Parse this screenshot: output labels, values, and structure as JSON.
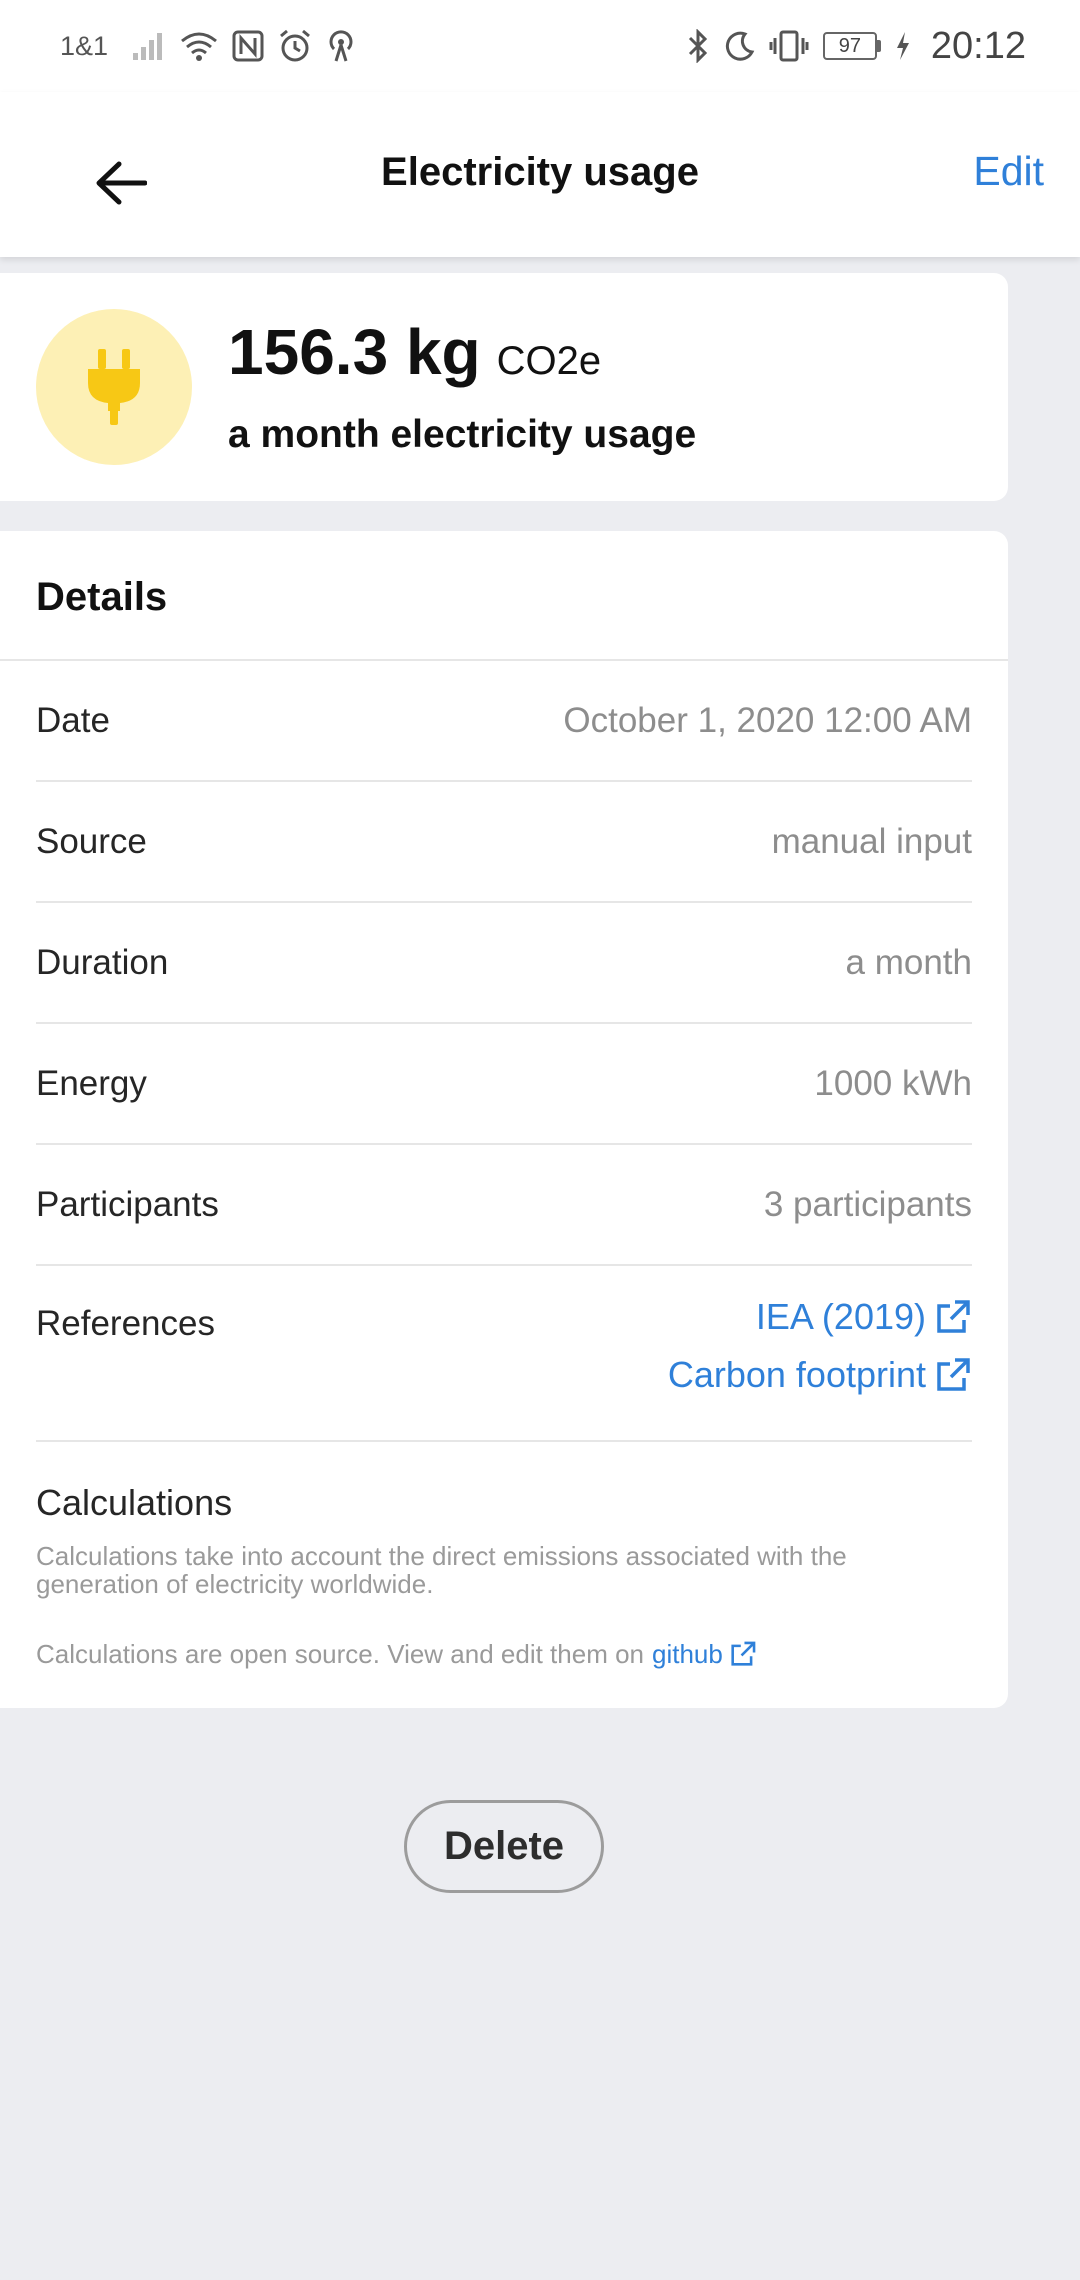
{
  "status_bar": {
    "carrier": "1&1",
    "battery": "97",
    "time": "20:12"
  },
  "appbar": {
    "title": "Electricity usage",
    "edit_label": "Edit"
  },
  "summary": {
    "amount": "156.3 kg",
    "unit": "CO2e",
    "label": "a month electricity usage",
    "accent_color": "#f7c815",
    "icon_bg_color": "#fdf0b5"
  },
  "details": {
    "title": "Details",
    "rows": [
      {
        "label": "Date",
        "value": "October 1, 2020 12:00 AM"
      },
      {
        "label": "Source",
        "value": "manual input"
      },
      {
        "label": "Duration",
        "value": "a month"
      },
      {
        "label": "Energy",
        "value": "1000 kWh"
      },
      {
        "label": "Participants",
        "value": "3 participants"
      }
    ],
    "references": {
      "label": "References",
      "links": [
        "IEA (2019)",
        "Carbon footprint"
      ]
    },
    "calculations": {
      "title": "Calculations",
      "text1": "Calculations take into account the direct emissions associated with the generation of electricity worldwide.",
      "text2": "Calculations are open source. View and edit them on",
      "link": "github"
    }
  },
  "delete_label": "Delete",
  "colors": {
    "link": "#2f80d9",
    "background": "#ecedf1"
  }
}
